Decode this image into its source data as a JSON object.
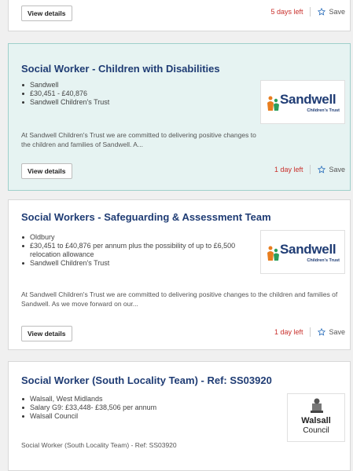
{
  "jobs": [
    {
      "view_label": "View details",
      "days_left": "5 days left",
      "save_label": "Save"
    },
    {
      "title": "Social Worker - Children with Disabilities",
      "facts": [
        "Sandwell",
        "£30,451 - £40,876",
        "Sandwell Children's Trust"
      ],
      "description": "At Sandwell Children's Trust we are committed to delivering positive changes to the children and families of Sandwell. A...",
      "view_label": "View details",
      "days_left": "1 day left",
      "save_label": "Save",
      "logo": {
        "name": "Sandwell",
        "sub": "Children's Trust"
      }
    },
    {
      "title": "Social Workers - Safeguarding & Assessment Team",
      "facts": [
        "Oldbury",
        "£30,451 to £40,876 per annum plus the possibility of up to £6,500 relocation allowance",
        "Sandwell Children's Trust"
      ],
      "description": "At Sandwell Children's Trust we are committed to delivering positive changes to the children and families of Sandwell. As we move forward on our...",
      "view_label": "View details",
      "days_left": "1 day left",
      "save_label": "Save",
      "logo": {
        "name": "Sandwell",
        "sub": "Children's Trust"
      }
    },
    {
      "title": "Social Worker (South Locality Team) - Ref: SS03920",
      "facts": [
        "Walsall, West Midlands",
        "Salary G9: £33,448- £38,506 per annum",
        "Walsall Council"
      ],
      "description": "Social Worker (South Locality Team) - Ref: SS03920",
      "logo": {
        "name": "Walsall",
        "sub": "Council"
      }
    }
  ],
  "colors": {
    "title": "#1f3c74",
    "days_left": "#c9302c",
    "featured_bg": "#e6f3f2"
  }
}
